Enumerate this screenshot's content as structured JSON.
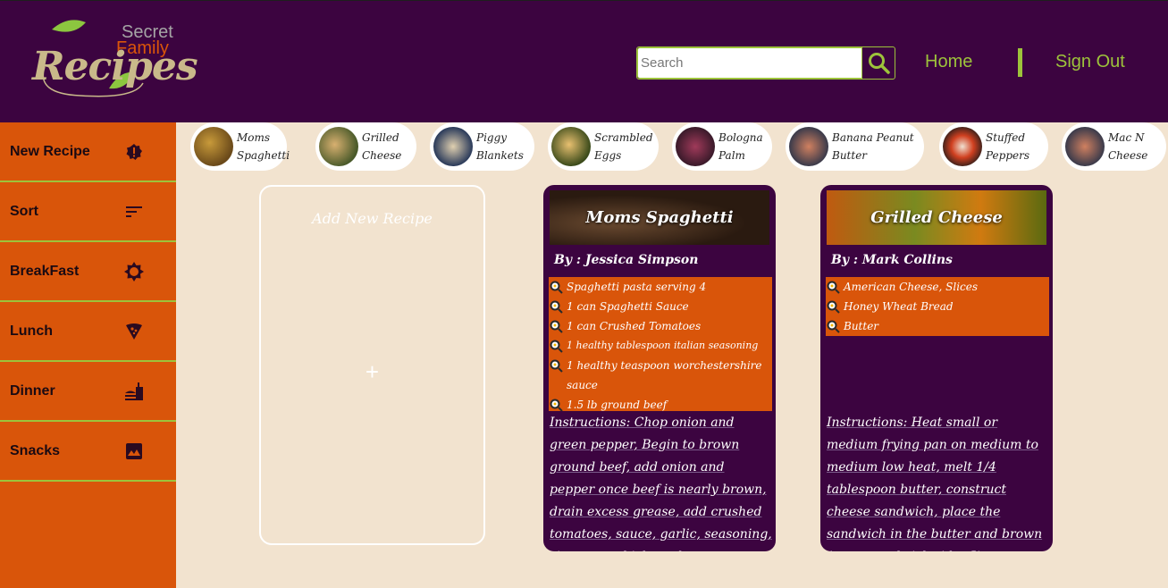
{
  "header": {
    "logo": {
      "secret": "Secret",
      "family": "Family",
      "recipes": "Recipes"
    },
    "search": {
      "placeholder": "Search"
    },
    "nav": {
      "home": "Home",
      "sign_out": "Sign Out"
    }
  },
  "sidebar": {
    "items": [
      {
        "label": "New Recipe",
        "icon": "new-badge-icon"
      },
      {
        "label": "Sort",
        "icon": "sort-icon"
      },
      {
        "label": "BreakFast",
        "icon": "sun-icon"
      },
      {
        "label": "Lunch",
        "icon": "pizza-icon"
      },
      {
        "label": "Dinner",
        "icon": "fastfood-icon"
      },
      {
        "label": "Snacks",
        "icon": "image-icon"
      }
    ]
  },
  "chips": [
    {
      "line1": "Moms",
      "line2": "Spaghetti"
    },
    {
      "line1": "Grilled",
      "line2": "Cheese"
    },
    {
      "line1": "Piggy",
      "line2": "Blankets"
    },
    {
      "line1": "Scrambled",
      "line2": "Eggs"
    },
    {
      "line1": "Bologna",
      "line2": "Palm"
    },
    {
      "line1": "Banana Peanut",
      "line2": "Butter"
    },
    {
      "line1": "Stuffed",
      "line2": "Peppers"
    },
    {
      "line1": "Mac N",
      "line2": "Cheese"
    }
  ],
  "add_card": {
    "title": "Add New Recipe",
    "plus": "+"
  },
  "cards": [
    {
      "title": "Moms Spaghetti",
      "author": "By : Jessica Simpson",
      "ingredients": [
        "Spaghetti pasta serving 4",
        "1 can Spaghetti Sauce",
        "1 can Crushed Tomatoes",
        "1 healthy tablespoon italian seasoning",
        "1 healthy teaspoon worchestershire sauce",
        "1.5 lb ground beef"
      ],
      "instructions": "Instructions: Chop onion and green pepper, Begin to brown ground beef, add onion and pepper once beef is nearly brown, drain excess grease, add crushed tomatoes, sauce, garlic, seasoning, simmer to thicken, the"
    },
    {
      "title": "Grilled Cheese",
      "author": "By : Mark Collins",
      "ingredients": [
        "American Cheese, Slices",
        "Honey Wheat Bread",
        "Butter"
      ],
      "instructions": "Instructions: Heat small or medium frying pan on medium to medium low heat, melt 1/4 tablespoon butter, construct cheese sandwich, place the sandwich in the butter and brown / toast sandwich side, flip sandwich"
    }
  ],
  "colors": {
    "header_bg": "#3c0440",
    "accent_orange": "#d9550a",
    "accent_green": "#9dc33b",
    "page_bg": "#f2e3cf"
  }
}
